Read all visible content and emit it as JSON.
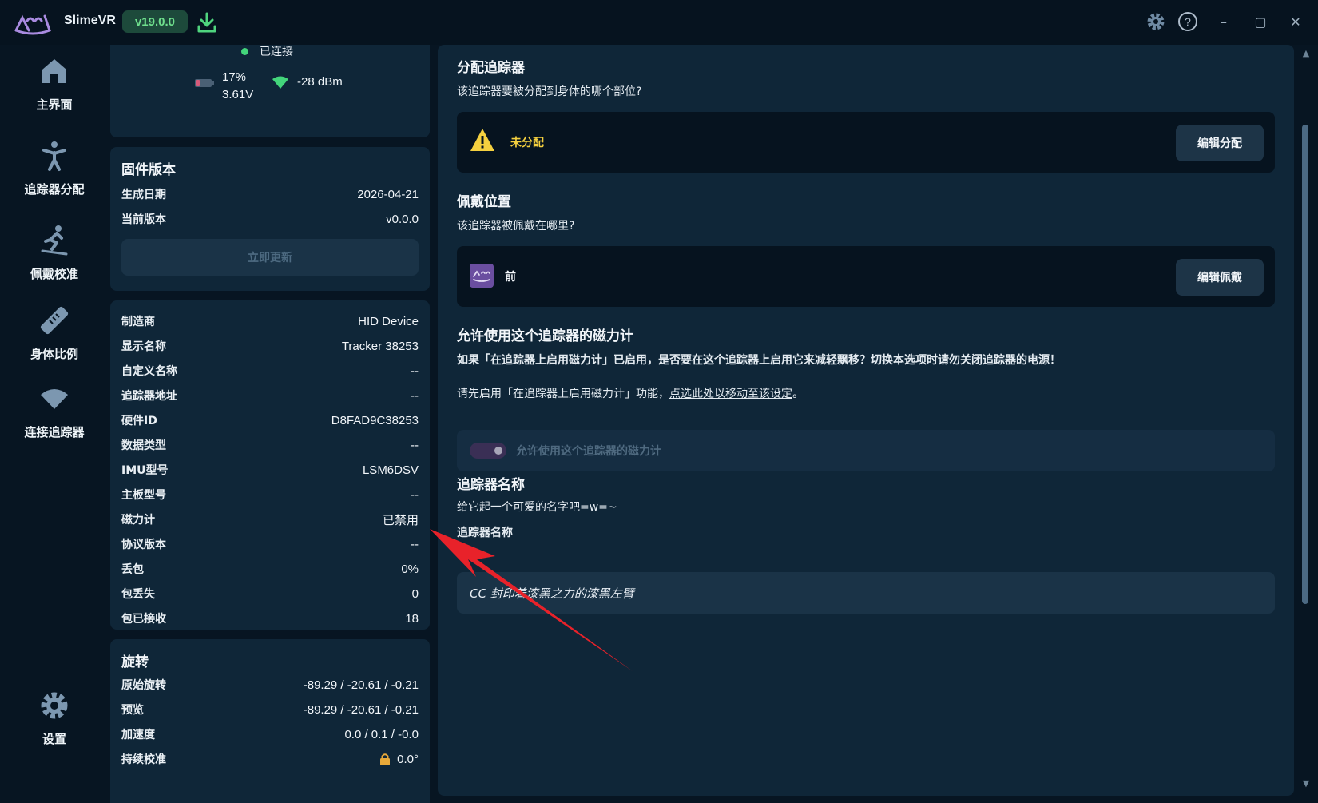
{
  "titlebar": {
    "app_name": "SlimeVR",
    "version": "v19.0.0",
    "window_controls": {
      "minimize": "–",
      "maximize": "▢",
      "close": "✕"
    }
  },
  "icons": {
    "logo": "slimevr-logo-icon",
    "download": "download-icon",
    "settings": "gear-icon",
    "help": "help-icon"
  },
  "colors": {
    "background": "#071522",
    "card": "#0f2638",
    "accent_green": "#6fe08d",
    "warning_yellow": "#f4d03f",
    "annotation_arrow": "#e8222a"
  },
  "sidebar": {
    "items": [
      {
        "label": "主界面",
        "icon": "home-icon"
      },
      {
        "label": "追踪器分配",
        "icon": "person-icon"
      },
      {
        "label": "佩戴校准",
        "icon": "skier-icon"
      },
      {
        "label": "身体比例",
        "icon": "ruler-icon"
      },
      {
        "label": "连接追踪器",
        "icon": "wifi-icon"
      },
      {
        "label": "设置",
        "icon": "gear-icon"
      }
    ]
  },
  "status": {
    "connection": "已连接",
    "battery_percent": "17%",
    "battery_voltage": "3.61V",
    "signal": "-28 dBm"
  },
  "firmware": {
    "title": "固件版本",
    "build_date_label": "生成日期",
    "build_date": "2026-04-21",
    "current_version_label": "当前版本",
    "current_version": "v0.0.0",
    "update_button": "立即更新"
  },
  "device_info": {
    "rows": [
      {
        "key": "制造商",
        "value": "HID Device"
      },
      {
        "key": "显示名称",
        "value": "Tracker 38253"
      },
      {
        "key": "自定义名称",
        "value": "--"
      },
      {
        "key": "追踪器地址",
        "value": "--"
      },
      {
        "key": "硬件ID",
        "value": "D8FAD9C38253"
      },
      {
        "key": "数据类型",
        "value": "--"
      },
      {
        "key": "IMU型号",
        "value": "LSM6DSV"
      },
      {
        "key": "主板型号",
        "value": "--"
      },
      {
        "key": "磁力计",
        "value": "已禁用"
      },
      {
        "key": "协议版本",
        "value": "--"
      },
      {
        "key": "丢包",
        "value": "0%"
      },
      {
        "key": "包丢失",
        "value": "0"
      },
      {
        "key": "包已接收",
        "value": "18"
      }
    ]
  },
  "rotation": {
    "title": "旋转",
    "rows": [
      {
        "key": "原始旋转",
        "value": "-89.29 / -20.61 / -0.21"
      },
      {
        "key": "预览",
        "value": "-89.29 / -20.61 / -0.21"
      },
      {
        "key": "加速度",
        "value": "0.0 / 0.1 / -0.0"
      },
      {
        "key": "持续校准",
        "value": "0.0°"
      }
    ]
  },
  "assignment": {
    "title": "分配追踪器",
    "desc": "该追踪器要被分配到身体的哪个部位?",
    "status": "未分配",
    "button": "编辑分配"
  },
  "mounting": {
    "title": "佩戴位置",
    "desc": "该追踪器被佩戴在哪里?",
    "value": "前",
    "button": "编辑佩戴"
  },
  "magnetometer": {
    "title": "允许使用这个追踪器的磁力计",
    "desc": "如果「在追踪器上启用磁力计」已启用，是否要在这个追踪器上启用它来减轻飘移？切换本选项时请勿关闭追踪器的电源！",
    "hint_prefix": "请先启用「在追踪器上启用磁力计」功能，",
    "hint_link": "点选此处以移动至该设定",
    "hint_suffix": "。",
    "toggle_label": "允许使用这个追踪器的磁力计"
  },
  "tracker_name": {
    "title": "追踪器名称",
    "desc": "给它起一个可爱的名字吧=w=~",
    "field_label": "追踪器名称",
    "value": "CC 封印着漆黑之力的漆黑左臂"
  }
}
